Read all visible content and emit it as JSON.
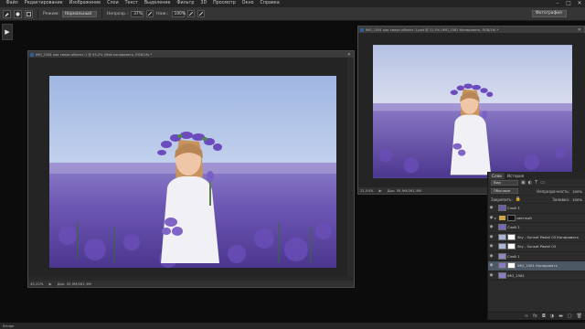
{
  "menubar": {
    "items": [
      "Файл",
      "Редактирование",
      "Изображение",
      "Слои",
      "Текст",
      "Выделение",
      "Фильтр",
      "3D",
      "Просмотр",
      "Окно",
      "Справка"
    ],
    "window_controls": [
      "–",
      "□",
      "✕"
    ]
  },
  "options_bar": {
    "mode_label": "Режим:",
    "mode_value": "Нормальный",
    "opacity_label": "Непрозр.:",
    "opacity_value": "37%",
    "flow_label": "Наж.:",
    "flow_value": "100%",
    "workspace": "Фотография"
  },
  "documents": [
    {
      "title": "IMG_1581 как смарт-объект-1 @ 45,2% (Мой копировать, RGB/16) *",
      "zoom": "45,22%",
      "doc_size": "Док: 55,9M/281,9M"
    },
    {
      "title": "IMG_1581 как смарт-объект-1.psd @ 21,5% (IMG_1581 Копировать, RGB/16) *",
      "zoom": "21,54%",
      "doc_size": "Док: 55,9M/281,9M"
    }
  ],
  "layers_panel": {
    "tabs": [
      "Слои",
      "История"
    ],
    "kind_label": "Вид",
    "blend_mode": "Обычные",
    "opacity_label": "Непрозрачность:",
    "opacity_value": "100%",
    "lock_label": "Закрепить:",
    "fill_label": "Заливка:",
    "fill_value": "100%",
    "layers": [
      {
        "name": "Слой 3",
        "visible": true,
        "type": "layer",
        "thumb_color": "#6b5ca5"
      },
      {
        "name": "светлый",
        "visible": true,
        "type": "folder",
        "thumb_color": "#d8d8d8"
      },
      {
        "name": "Слой 2",
        "visible": true,
        "type": "layer",
        "thumb_color": "#7869b8"
      },
      {
        "name": "Sky - Sunset Pastel 03 Копировать",
        "visible": true,
        "type": "mask",
        "thumb_color": "#aab6d6"
      },
      {
        "name": "Sky - Sunset Pastel 03",
        "visible": true,
        "type": "mask",
        "thumb_color": "#aab6d6"
      },
      {
        "name": "Слой 1",
        "visible": true,
        "type": "layer",
        "thumb_color": "#8f86bd"
      },
      {
        "name": "IMG_1581 Копировать",
        "visible": true,
        "type": "mask",
        "thumb_color": "#8a7cc1",
        "selected": true
      },
      {
        "name": "IMG_1581",
        "visible": true,
        "type": "layer",
        "thumb_color": "#8a7cc1"
      }
    ],
    "bottom_icons": [
      "link-icon",
      "fx-icon",
      "mask-icon",
      "adjustment-icon",
      "folder-icon",
      "new-layer-icon",
      "trash-icon"
    ]
  },
  "statusbar": {
    "text": "Bridge"
  }
}
